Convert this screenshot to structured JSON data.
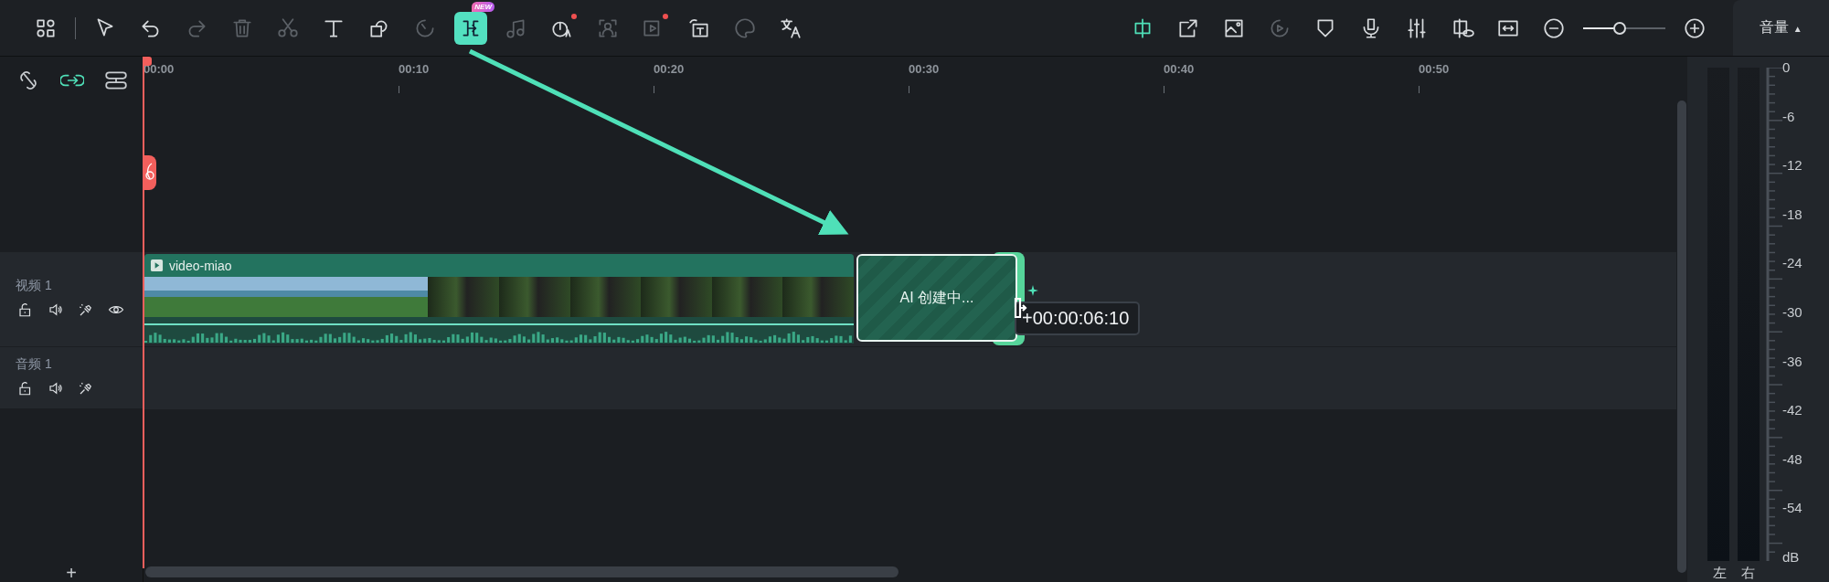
{
  "toolbar_left": [
    {
      "disabled": false,
      "selected": false,
      "dot": false
    },
    {
      "disabled": false,
      "selected": false,
      "dot": false
    },
    {
      "disabled": false,
      "selected": false,
      "dot": false
    },
    {
      "disabled": true,
      "selected": false,
      "dot": false
    },
    {
      "disabled": true,
      "selected": false,
      "dot": false
    },
    {
      "disabled": true,
      "selected": false,
      "dot": false
    },
    {
      "disabled": false,
      "selected": false,
      "dot": false
    },
    {
      "disabled": false,
      "selected": false,
      "dot": false
    },
    {
      "disabled": true,
      "selected": false,
      "dot": false
    },
    {
      "disabled": false,
      "selected": true,
      "dot": false,
      "badge": "NEW"
    },
    {
      "disabled": true,
      "selected": false,
      "dot": false
    },
    {
      "disabled": false,
      "selected": false,
      "dot": true
    },
    {
      "disabled": true,
      "selected": false,
      "dot": false
    },
    {
      "disabled": true,
      "selected": false,
      "dot": true
    },
    {
      "disabled": false,
      "selected": false,
      "dot": false
    },
    {
      "disabled": true,
      "selected": false,
      "dot": false
    },
    {
      "disabled": false,
      "selected": false,
      "dot": false
    }
  ],
  "toolbar_right": [
    {
      "disabled": false,
      "selected": true
    },
    {
      "disabled": false,
      "selected": false
    },
    {
      "disabled": false,
      "selected": false
    },
    {
      "disabled": true,
      "selected": false
    },
    {
      "disabled": false,
      "selected": false
    },
    {
      "disabled": false,
      "selected": false
    },
    {
      "disabled": false,
      "selected": false
    },
    {
      "disabled": false,
      "selected": false
    },
    {
      "disabled": false,
      "selected": false
    }
  ],
  "zoom_slider": {
    "level": 0.44
  },
  "volume_tab": {
    "label": "音量",
    "arrow": "▲"
  },
  "link_tools": [
    {
      "selected": false
    },
    {
      "selected": true
    },
    {
      "selected": false
    }
  ],
  "ruler": {
    "labels": [
      "00:00",
      "00:10",
      "00:20",
      "00:30",
      "00:40",
      "00:50"
    ]
  },
  "tracks": [
    {
      "kind": "video",
      "name": "视频 1"
    },
    {
      "kind": "audio",
      "name": "音频 1"
    }
  ],
  "clips": [
    {
      "kind": "video",
      "title": "video-miao"
    },
    {
      "kind": "ai",
      "label": "AI 创建中..."
    }
  ],
  "trim_tooltip": "+00:00:06:10",
  "meter": {
    "scale": [
      "0",
      "-6",
      "-12",
      "-18",
      "-24",
      "-30",
      "-36",
      "-42",
      "-48",
      "-54",
      "dB"
    ],
    "channels": [
      "左",
      "右"
    ]
  },
  "add_track": "+"
}
